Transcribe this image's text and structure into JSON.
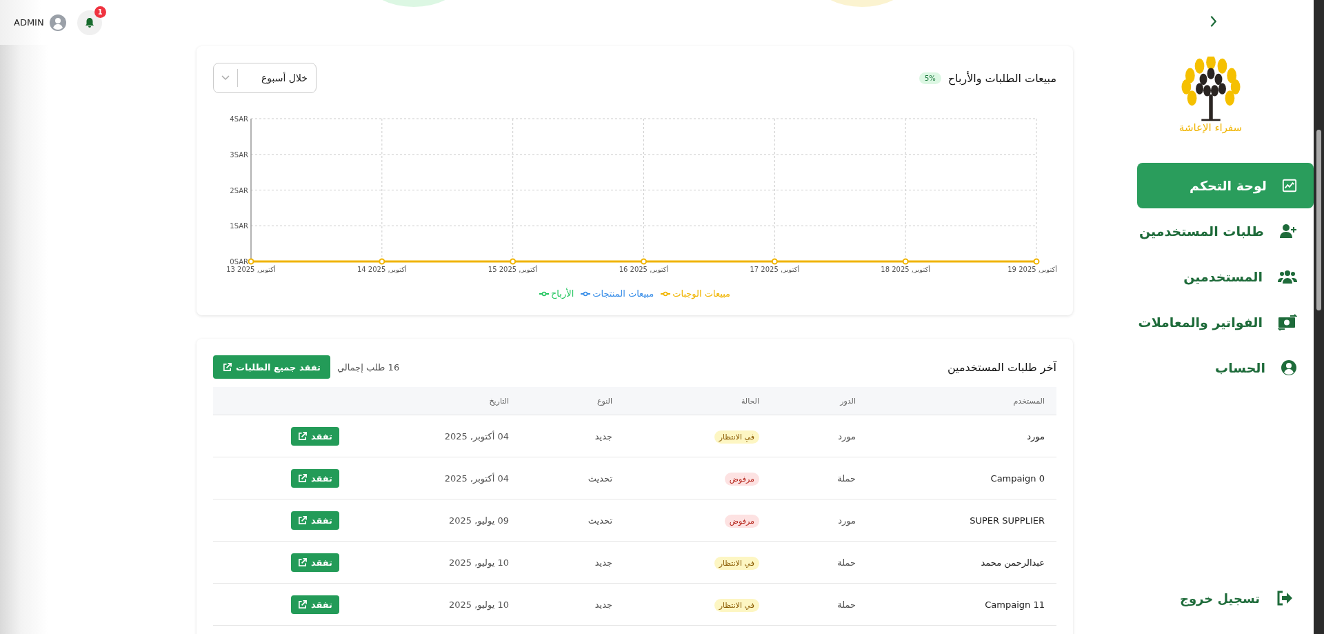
{
  "topbar": {
    "user": "ADMIN",
    "notifications": "1"
  },
  "sales_card": {
    "title": "مبيعات الطلبات والأرباح",
    "badge": "5%",
    "period": "خلال أسبوع",
    "chart_data": {
      "type": "line",
      "categories": [
        "13 أكتوبر, 2025",
        "14 أكتوبر, 2025",
        "15 أكتوبر, 2025",
        "16 أكتوبر, 2025",
        "17 أكتوبر, 2025",
        "18 أكتوبر, 2025",
        "19 أكتوبر, 2025"
      ],
      "series": [
        {
          "name": "مبيعات الوجبات",
          "color": "#f0b400",
          "marker": true,
          "values": [
            0,
            0,
            0,
            0,
            0,
            0,
            0
          ]
        },
        {
          "name": "مبيعات المنتجات",
          "color": "#3b8fe8",
          "marker": true,
          "values": [
            null,
            null,
            null,
            null,
            null,
            null,
            null
          ]
        },
        {
          "name": "الأرباح",
          "color": "#22c55e",
          "marker": true,
          "values": [
            null,
            null,
            null,
            null,
            null,
            null,
            null
          ]
        }
      ],
      "grid": true,
      "ylim": [
        0,
        4
      ],
      "yticks": [
        {
          "value": 0,
          "label": "0SAR"
        },
        {
          "value": 1,
          "label": "1SAR"
        },
        {
          "value": 2,
          "label": "2SAR"
        },
        {
          "value": 3,
          "label": "3SAR"
        },
        {
          "value": 4,
          "label": "4SAR"
        }
      ]
    }
  },
  "requests_card": {
    "title": "آخر طلبات المستخدمين",
    "total": "16 طلب إجمالي",
    "view_all": "تفقد جميع الطلبات",
    "columns": [
      "المستخدم",
      "الدور",
      "الحالة",
      "النوع",
      "التاريخ"
    ],
    "rows": [
      {
        "user": "مورد",
        "role": "مورد",
        "status": "في الانتظار",
        "kind": "pending",
        "type": "جديد",
        "date": "04 أكتوبر, 2025",
        "action": "تفقد"
      },
      {
        "user": "Campaign 0",
        "role": "حملة",
        "status": "مرفوض",
        "kind": "rejected",
        "type": "تحديث",
        "date": "04 أكتوبر, 2025",
        "action": "تفقد"
      },
      {
        "user": "SUPER SUPPLIER",
        "role": "مورد",
        "status": "مرفوض",
        "kind": "rejected",
        "type": "تحديث",
        "date": "09 يوليو, 2025",
        "action": "تفقد"
      },
      {
        "user": "عبدالرحمن محمد",
        "role": "حملة",
        "status": "في الانتظار",
        "kind": "pending",
        "type": "جديد",
        "date": "10 يوليو, 2025",
        "action": "تفقد"
      },
      {
        "user": "Campaign 11",
        "role": "حملة",
        "status": "في الانتظار",
        "kind": "pending",
        "type": "جديد",
        "date": "10 يوليو, 2025",
        "action": "تفقد"
      }
    ]
  },
  "sidebar": {
    "logo_text": "سفراء الإعاشة",
    "items": [
      {
        "label": "لوحة التحكم",
        "kind": "chart",
        "selected": true
      },
      {
        "label": "طلبات المستخدمين",
        "kind": "user-plus",
        "selected": false
      },
      {
        "label": "المستخدمين",
        "kind": "users",
        "selected": false
      },
      {
        "label": "الفواتير والمعاملات",
        "kind": "money",
        "selected": false
      },
      {
        "label": "الحساب",
        "kind": "account",
        "selected": false
      }
    ],
    "logout": "تسجيل خروج"
  }
}
